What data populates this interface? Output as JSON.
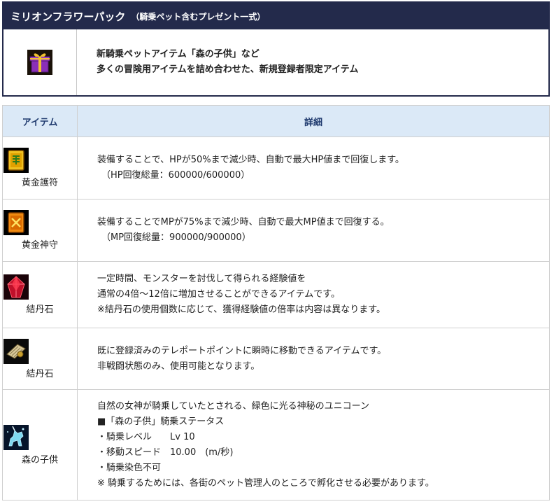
{
  "package": {
    "title": "ミリオンフラワーパック",
    "subtitle": "（騎乗ペット含むプレゼント一式）",
    "icon": "gift-box-icon",
    "description": [
      "新騎乗ペットアイテム「森の子供」など",
      "多くの冒険用アイテムを詰め合わせた、新規登録者限定アイテム"
    ]
  },
  "table": {
    "headers": {
      "item": "アイテム",
      "detail": "詳細"
    },
    "rows": [
      {
        "icon": "golden-talisman-icon",
        "name": "黄金護符",
        "lines": [
          "装備することで、HPが50%まで減少時、自動で最大HP値まで回復します。",
          "（HP回復総量：600000/600000）"
        ]
      },
      {
        "icon": "golden-guardian-icon",
        "name": "黄金神守",
        "lines": [
          "装備することでMPが75%まで減少時、自動で最大MP値まで回復する。",
          "（MP回復総量：900000/900000）"
        ]
      },
      {
        "icon": "red-crystal-icon",
        "name": "結丹石",
        "lines": [
          "一定時間、モンスターを討伐して得られる経験値を",
          "通常の4倍～12倍に増加させることができるアイテムです。",
          "※結丹石の使用個数に応じて、獲得経験値の倍率は内容は異なります。"
        ]
      },
      {
        "icon": "teleport-scroll-icon",
        "name": "結丹石",
        "lines": [
          "既に登録済みのテレポートポイントに瞬時に移動できるアイテムです。",
          "非戦闘状態のみ、使用可能となります。"
        ]
      },
      {
        "icon": "unicorn-icon",
        "name": "森の子供",
        "lines": [
          "自然の女神が騎乗していたとされる、緑色に光る神秘のユニコーン",
          "■「森の子供」騎乗ステータス",
          "・騎乗レベル　　Lv 10",
          "・移動スピード　10.00　(m/秒)",
          "・騎乗染色不可",
          "※ 騎乗するためには、各街のペット管理人のところで孵化させる必要があります。"
        ]
      }
    ]
  },
  "colors": {
    "header_bg": "#232a4b",
    "table_header_bg": "#dbe9f7",
    "table_header_text": "#1f3a6e",
    "border": "#cfcfcf"
  }
}
